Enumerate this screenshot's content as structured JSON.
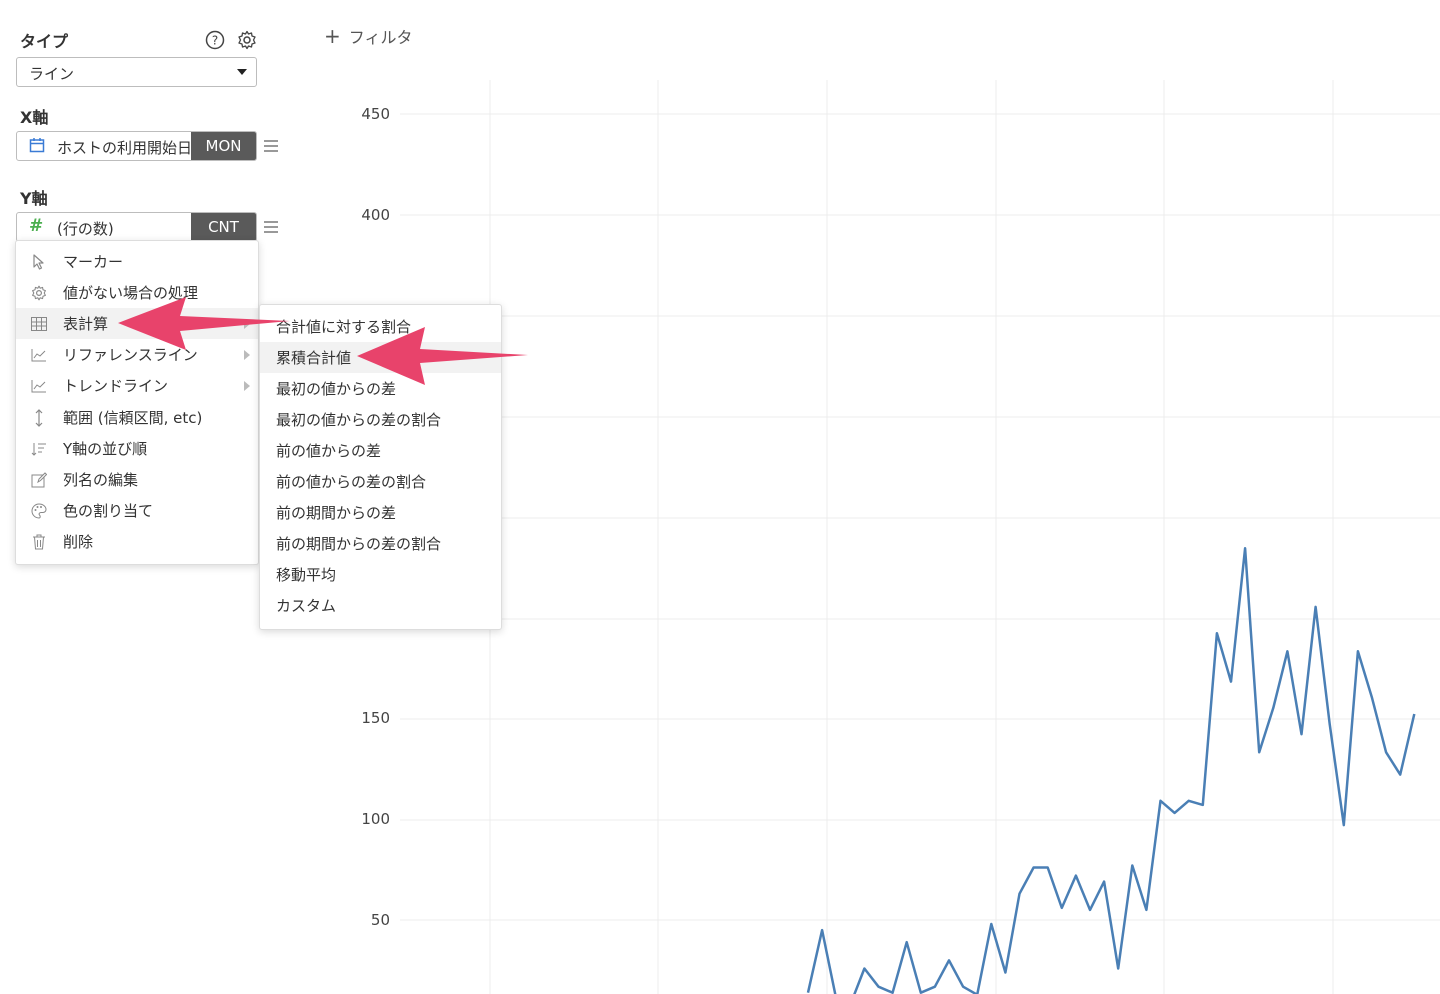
{
  "sidebar": {
    "type_label": "タイプ",
    "type_value": "ライン",
    "x_axis_label": "X軸",
    "x_axis_field": "ホストの利用開始日",
    "x_axis_agg": "MON",
    "y_axis_label": "Y軸",
    "y_axis_field": "(行の数)",
    "y_axis_agg": "CNT"
  },
  "filter": {
    "label": "フィルタ"
  },
  "context_menu": {
    "items": [
      {
        "label": "マーカー",
        "icon": "pointer-icon"
      },
      {
        "label": "値がない場合の処理",
        "icon": "gear-icon"
      },
      {
        "label": "表計算",
        "icon": "table-icon"
      },
      {
        "label": "リファレンスライン",
        "icon": "reference-line-icon"
      },
      {
        "label": "トレンドライン",
        "icon": "trend-line-icon"
      },
      {
        "label": "範囲 (信頼区間, etc)",
        "icon": "vertical-range-icon"
      },
      {
        "label": "Y軸の並び順",
        "icon": "sort-icon"
      },
      {
        "label": "列名の編集",
        "icon": "edit-icon"
      },
      {
        "label": "色の割り当て",
        "icon": "palette-icon"
      },
      {
        "label": "削除",
        "icon": "trash-icon"
      }
    ]
  },
  "submenu": {
    "items": [
      {
        "label": "合計値に対する割合"
      },
      {
        "label": "累積合計値"
      },
      {
        "label": "最初の値からの差"
      },
      {
        "label": "最初の値からの差の割合"
      },
      {
        "label": "前の値からの差"
      },
      {
        "label": "前の値からの差の割合"
      },
      {
        "label": "前の期間からの差"
      },
      {
        "label": "前の期間からの差の割合"
      },
      {
        "label": "移動平均"
      },
      {
        "label": "カスタム"
      }
    ]
  },
  "colors": {
    "line": "#4a7fb5",
    "arrow": "#e8436b",
    "tag_bg": "#5a5a5a",
    "calendar": "#3a7bd5",
    "hash": "#4caf50"
  },
  "chart_data": {
    "type": "line",
    "ytick_labels": [
      "50",
      "100",
      "150",
      "400",
      "450"
    ],
    "series": [
      {
        "values": [
          {
            "i": 0,
            "v": 14
          },
          {
            "i": 1,
            "v": 45
          },
          {
            "i": 2,
            "v": 11
          },
          {
            "i": 3,
            "v": 8
          },
          {
            "i": 4,
            "v": 26
          },
          {
            "i": 5,
            "v": 17
          },
          {
            "i": 6,
            "v": 14
          },
          {
            "i": 7,
            "v": 39
          },
          {
            "i": 8,
            "v": 14
          },
          {
            "i": 9,
            "v": 17
          },
          {
            "i": 10,
            "v": 30
          },
          {
            "i": 11,
            "v": 17
          },
          {
            "i": 12,
            "v": 13
          },
          {
            "i": 13,
            "v": 48
          },
          {
            "i": 14,
            "v": 24
          },
          {
            "i": 15,
            "v": 63
          },
          {
            "i": 16,
            "v": 76
          },
          {
            "i": 17,
            "v": 76
          },
          {
            "i": 18,
            "v": 56
          },
          {
            "i": 19,
            "v": 72
          },
          {
            "i": 20,
            "v": 55
          },
          {
            "i": 21,
            "v": 69
          },
          {
            "i": 22,
            "v": 26
          },
          {
            "i": 23,
            "v": 77
          },
          {
            "i": 24,
            "v": 55
          },
          {
            "i": 25,
            "v": 109
          },
          {
            "i": 26,
            "v": 103
          },
          {
            "i": 27,
            "v": 109
          },
          {
            "i": 28,
            "v": 107
          },
          {
            "i": 29,
            "v": 192
          },
          {
            "i": 30,
            "v": 168
          },
          {
            "i": 31,
            "v": 234
          },
          {
            "i": 32,
            "v": 133
          },
          {
            "i": 33,
            "v": 155
          },
          {
            "i": 34,
            "v": 183
          },
          {
            "i": 35,
            "v": 142
          },
          {
            "i": 36,
            "v": 205
          },
          {
            "i": 37,
            "v": 147
          },
          {
            "i": 38,
            "v": 97
          },
          {
            "i": 39,
            "v": 183
          },
          {
            "i": 40,
            "v": 160
          },
          {
            "i": 41,
            "v": 133
          },
          {
            "i": 42,
            "v": 122
          },
          {
            "i": 43,
            "v": 152
          }
        ]
      }
    ],
    "grid": true
  }
}
